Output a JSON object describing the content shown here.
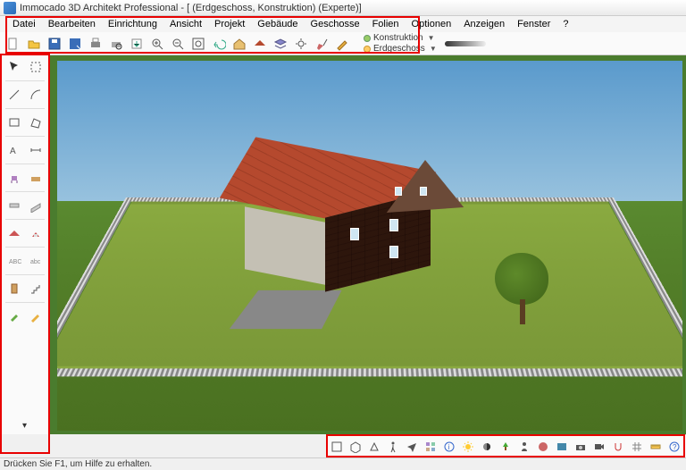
{
  "window": {
    "title": "Immocado 3D Architekt Professional - [ (Erdgeschoss, Konstruktion) (Experte)]"
  },
  "menu": {
    "items": [
      "Datei",
      "Bearbeiten",
      "Einrichtung",
      "Ansicht",
      "Projekt",
      "Gebäude",
      "Geschosse",
      "Folien",
      "Optionen",
      "Anzeigen",
      "Fenster",
      "?"
    ]
  },
  "toolbar_top": {
    "icons": [
      "new",
      "open",
      "save",
      "sep",
      "print",
      "print-setup",
      "export",
      "sep",
      "zoom-in",
      "zoom-out",
      "sep",
      "undo",
      "redo",
      "sep",
      "house",
      "roof",
      "layers",
      "sep",
      "settings",
      "brush",
      "dim"
    ],
    "layer_dropdown_1": "Konstruktion",
    "layer_dropdown_2": "Erdgeschoss"
  },
  "left_tools": {
    "groups": [
      [
        "pointer",
        "select-area"
      ],
      [
        "line",
        "arc"
      ],
      [
        "rect",
        "poly"
      ],
      [
        "text",
        "dim"
      ],
      [
        "chair",
        "desk"
      ],
      [
        "wall",
        "wall2"
      ],
      [
        "roof",
        "roof2"
      ],
      [
        "abc",
        "abc2"
      ],
      [
        "door",
        "stairs"
      ],
      [
        "paint",
        "pick"
      ]
    ],
    "expand": "▾"
  },
  "bottom_tools": {
    "icons": [
      "2d",
      "3d",
      "persp",
      "sep",
      "walk",
      "fly",
      "sep",
      "catalog",
      "info",
      "sep",
      "sun",
      "shadow",
      "sep",
      "tree",
      "person",
      "sep",
      "material",
      "render",
      "sep",
      "camera",
      "video",
      "sep",
      "snap",
      "grid",
      "sep",
      "measure",
      "help"
    ]
  },
  "status": {
    "text": "Drücken Sie F1, um Hilfe zu erhalten."
  },
  "scene": {
    "colors": {
      "sky_top": "#5a9acc",
      "sky_bottom": "#9ec6e0",
      "grass": "#4a7c2e",
      "lawn": "#8aaa40",
      "roof": "#b5492e",
      "brick": "#6b4a38",
      "side_wall": "#c4c0b4",
      "path": "#888888",
      "tree": "#5e8a2a",
      "fence": "#cccccc"
    }
  }
}
